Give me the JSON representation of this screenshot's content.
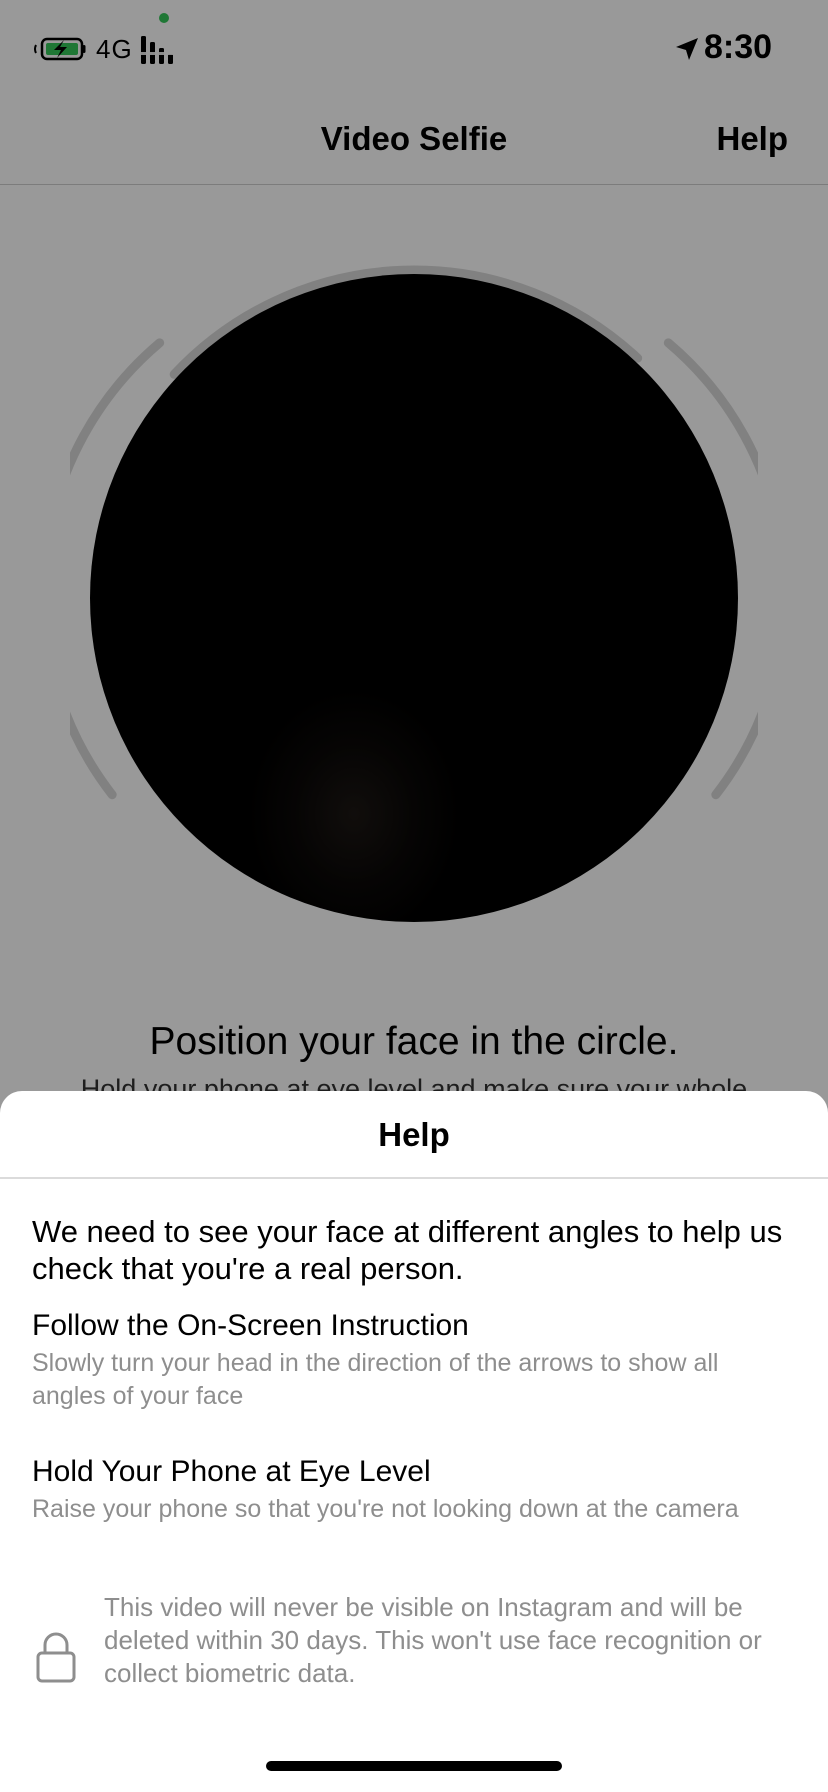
{
  "status_bar": {
    "network": "4G",
    "time": "8:30",
    "icons": [
      "battery-charging-icon",
      "signal-bars-icon",
      "location-arrow-icon"
    ]
  },
  "nav": {
    "title": "Video Selfie",
    "help_label": "Help"
  },
  "camera": {
    "instruction_title": "Position your face in the circle.",
    "instruction_subtitle": "Hold your phone at eye level and make sure your whole"
  },
  "sheet": {
    "title": "Help",
    "intro": "We need to see your face at different angles to help us check that you're a real person.",
    "tips": [
      {
        "title": "Follow the On-Screen Instruction",
        "body": "Slowly turn your head in the direction of the arrows to show all angles of your face"
      },
      {
        "title": "Hold Your Phone at Eye Level",
        "body": "Raise your phone so that you're not looking down at the camera"
      }
    ],
    "privacy_note": "This video will never be visible on Instagram and will be deleted within 30 days. This won't use face recognition or collect biometric data.",
    "privacy_icon": "lock-icon"
  },
  "colors": {
    "dim_overlay": "#999999",
    "secondary_text": "#8e8e8e",
    "camera_indicator": "#34c759"
  }
}
